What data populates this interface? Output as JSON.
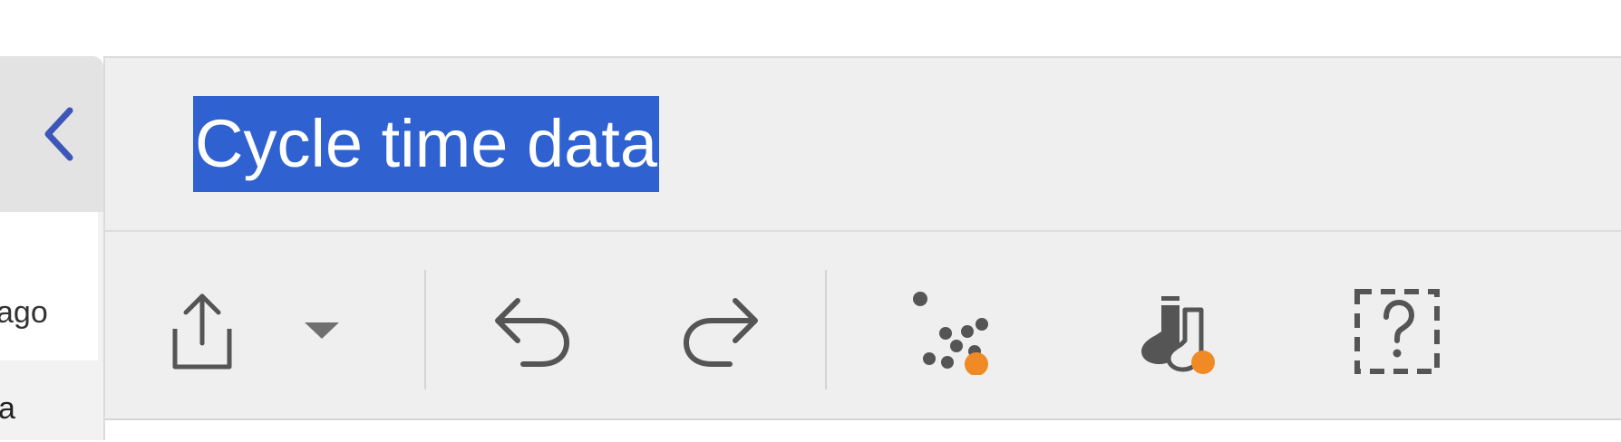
{
  "header": {
    "title": "Cycle time data"
  },
  "left_panel": {
    "partial_text_1": "ago",
    "partial_text_2": "a",
    "collapse_icon": "chevron-left-icon"
  },
  "toolbar": {
    "items": [
      {
        "name": "share",
        "icon": "share-icon"
      },
      {
        "name": "share-dropdown",
        "icon": "caret-down-icon"
      },
      {
        "name": "undo",
        "icon": "undo-icon"
      },
      {
        "name": "redo",
        "icon": "redo-icon"
      },
      {
        "name": "scatter-analysis",
        "icon": "scatter-dots-icon"
      },
      {
        "name": "socks",
        "icon": "socks-icon"
      },
      {
        "name": "help",
        "icon": "help-question-icon"
      }
    ]
  },
  "colors": {
    "accent": "#2f62d0",
    "chevron": "#3d57b8",
    "icon_gray": "#555555",
    "badge_orange": "#f08a24"
  }
}
